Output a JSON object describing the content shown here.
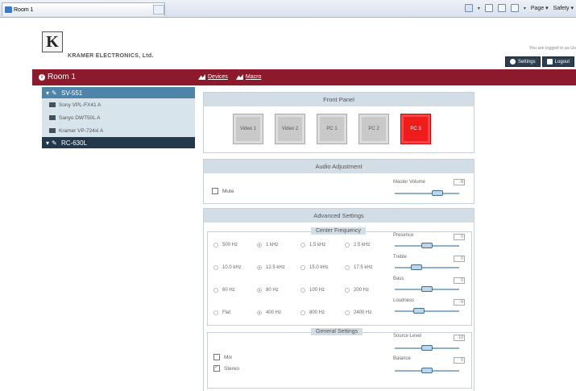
{
  "browser": {
    "tab_title": "Room 1",
    "page_menu": "Page",
    "safety_menu": "Safety"
  },
  "header": {
    "company": "KRAMER ELECTRONICS, Ltd.",
    "logo_letter": "K",
    "logged_in_text": "You are logged in as Us",
    "settings_label": "Settings",
    "logout_label": "Logout"
  },
  "room": {
    "title": "Room 1",
    "devices_link": "Devices",
    "macro_link": "Macro"
  },
  "tree": {
    "group1": "SV-551",
    "items": [
      "Sony VPL-FX41 A",
      "Sanyo DWT50L A",
      "Kramer VP-724xl A"
    ],
    "group2": "RC-630L"
  },
  "front_panel": {
    "title": "Front Panel",
    "buttons": [
      "Video 1",
      "Video 2",
      "PC 1",
      "PC 2",
      "PC 3"
    ],
    "active_index": 4,
    "active_color": "#ef1c1c"
  },
  "audio": {
    "title": "Audio Adjustment",
    "mute_label": "Mute",
    "master_volume_label": "Master Volume",
    "master_volume_value": "-8",
    "master_volume_level": 0.7
  },
  "advanced": {
    "title": "Advanced Settings",
    "center_frequency_title": "Center Frequency",
    "frequencies": [
      [
        "500 Hz",
        "1 kHz",
        "1.5 kHz",
        "2.5 kHz"
      ],
      [
        "10.0 kHz",
        "12.5 kHz",
        "15.0 kHz",
        "17.5 kHz"
      ],
      [
        "60 Hz",
        "80 Hz",
        "100 Hz",
        "200 Hz"
      ],
      [
        "Flat",
        "400 Hz",
        "800 Hz",
        "2400 Hz"
      ]
    ],
    "selected_frequency": {
      "column": 1
    },
    "eq": [
      {
        "label": "Presence",
        "value": "0",
        "level": 0.5
      },
      {
        "label": "Treble",
        "value": "0",
        "level": 0.3
      },
      {
        "label": "Bass",
        "value": "0",
        "level": 0.5
      },
      {
        "label": "Loudness",
        "value": "-9",
        "level": 0.35
      }
    ],
    "general_settings_title": "General Settings",
    "mix_label": "Mix",
    "stereo_label": "Stereo",
    "stereo_checked": true,
    "source_level_label": "Source Level",
    "source_level_value": "-10",
    "source_level": 0.5,
    "balance_label": "Balance",
    "balance_value": "0",
    "balance_level": 0.5
  }
}
